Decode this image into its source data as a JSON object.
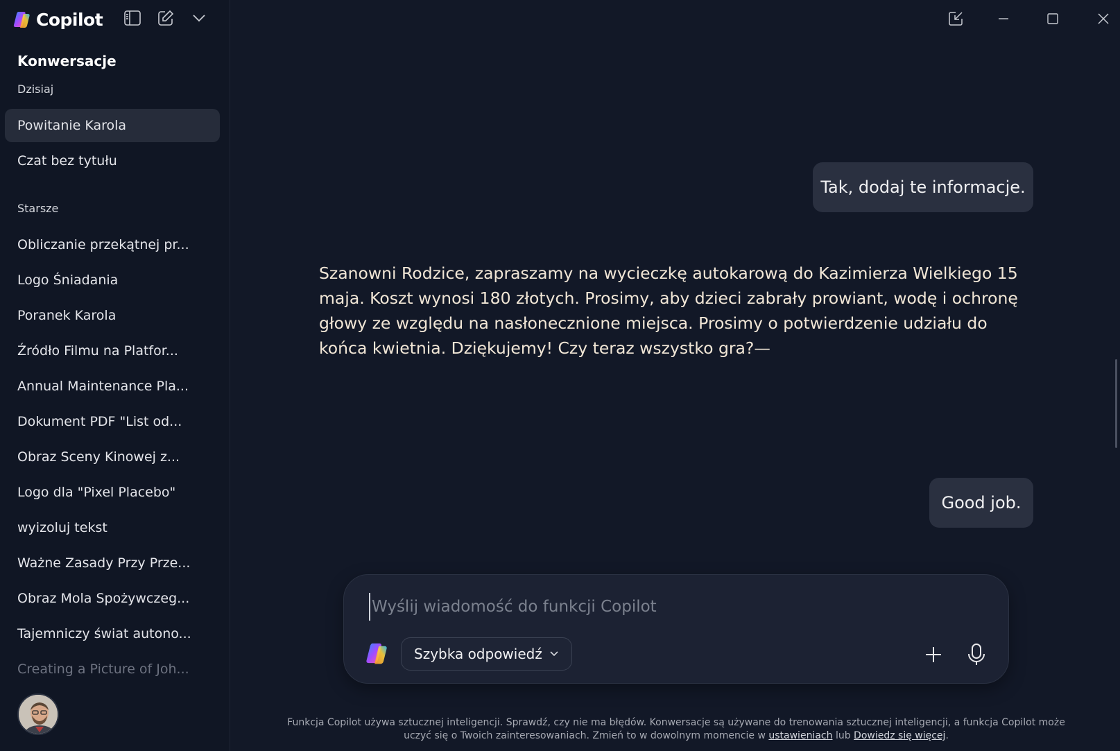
{
  "app": {
    "brand": "Copilot"
  },
  "sidebar": {
    "heading": "Konwersacje",
    "today_label": "Dzisiaj",
    "today_items": [
      {
        "label": "Powitanie Karola",
        "active": true
      },
      {
        "label": "Czat bez tytułu"
      }
    ],
    "older_label": "Starsze",
    "older_items": [
      "Obliczanie przekątnej pr...",
      "Logo Śniadania",
      "Poranek Karola",
      "Źródło Filmu na Platfor...",
      "Annual Maintenance Pla...",
      "Dokument PDF \"List od...",
      "Obraz Sceny Kinowej z...",
      "Logo dla \"Pixel Placebo\"",
      "wyizoluj tekst",
      "Ważne Zasady Przy Prze...",
      "Obraz Mola Spożywczeg...",
      "Tajemniczy świat autono...",
      "Creating a Picture of Joh..."
    ]
  },
  "chat": {
    "user_msg_1": "Tak, dodaj te informacje.",
    "assistant_msg": "Szanowni Rodzice, zapraszamy na wycieczkę autokarową do Kazimierza Wielkiego 15 maja. Koszt wynosi 180 złotych. Prosimy, aby dzieci zabrały prowiant, wodę i ochronę głowy ze względu na nasłonecznione miejsca. Prosimy o potwierdzenie udziału do końca kwietnia. Dziękujemy! Czy teraz wszystko gra?—",
    "user_msg_2": "Good job."
  },
  "composer": {
    "placeholder": "Wyślij wiadomość do funkcji Copilot",
    "mode_label": "Szybka odpowiedź"
  },
  "footer": {
    "text_before": "Funkcja Copilot używa sztucznej inteligencji. Sprawdź, czy nie ma błędów. Konwersacje są używane do trenowania sztucznej inteligencji, a funkcja Copilot może uczyć się o Twoich zainteresowaniach. Zmień to w dowolnym momencie w",
    "settings_link": "ustawieniach",
    "or_text": "lub",
    "learn_more_link": "Dowiedz się więcej",
    "end": "."
  },
  "colors": {
    "background": "#121827",
    "sidebar": "#101624",
    "bubble": "#2a3040",
    "assistant_text": "#f1e6d6"
  }
}
